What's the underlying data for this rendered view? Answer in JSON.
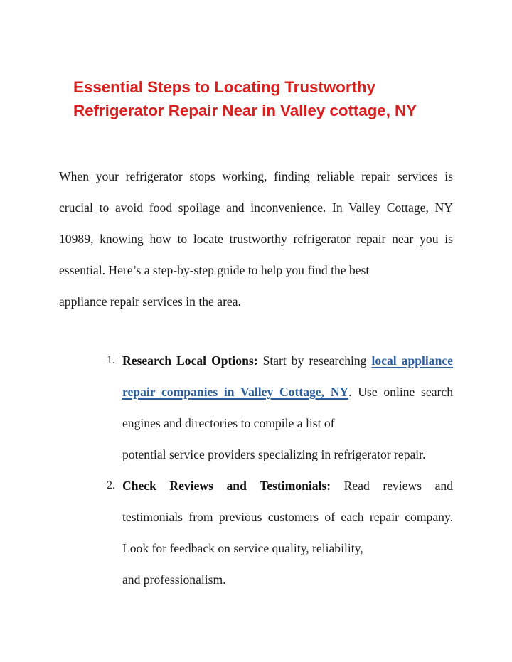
{
  "document": {
    "title": "Essential Steps to Locating Trustworthy Refrigerator Repair Near in Valley cottage, NY",
    "title_color": "#d8201f",
    "background_color": "#ffffff",
    "body_text_color": "#1b1b1b",
    "link_color": "#2d5f9e"
  },
  "intro": {
    "text": "When your refrigerator stops working, finding reliable repair services is crucial to avoid food spoilage and inconvenience. In Valley Cottage, NY 10989, knowing how to locate trustworthy refrigerator repair near you is essential. Here’s a step-by-step guide to help you find the best",
    "last_line": "appliance repair services in the area."
  },
  "steps": [
    {
      "marker": "1.",
      "lead": "Research Local Options:",
      "body_before_link": " Start by researching ",
      "link_text": "local appliance repair companies in Valley Cottage, NY",
      "body_after_link": ". Use online search engines and directories to compile a list of",
      "tail_line": "potential service providers specializing in refrigerator repair."
    },
    {
      "marker": "2.",
      "lead": "Check Reviews and Testimonials:",
      "body_before_link": " Read reviews and testimonials from previous customers of each repair company. Look for feedback on service quality, reliability,",
      "link_text": "",
      "body_after_link": "",
      "tail_line": "and professionalism."
    }
  ]
}
